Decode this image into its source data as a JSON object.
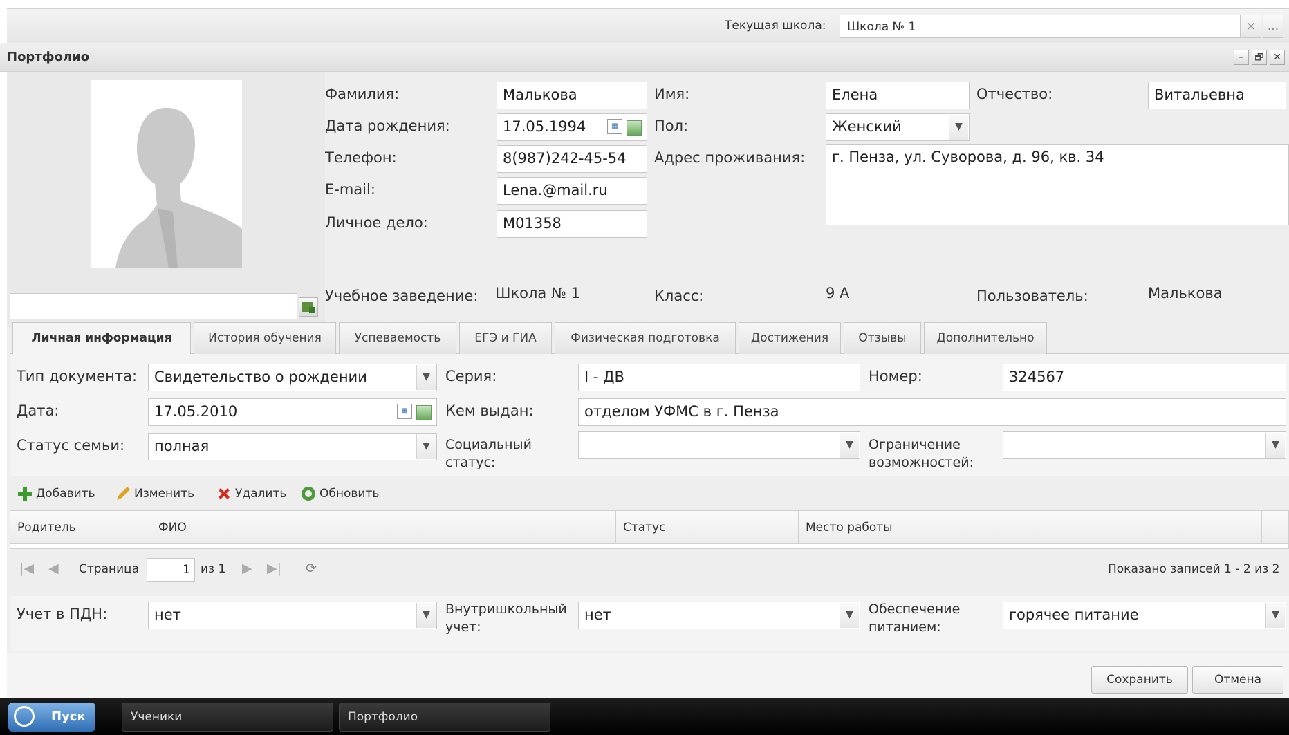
{
  "topbar": {
    "school_label": "Текущая школа:",
    "school_value": "Школа № 1",
    "clear_icon": "×",
    "more_icon": "..."
  },
  "window": {
    "title": "Портфолио",
    "min_icon": "–",
    "restore_icon": "🗗",
    "close_icon": "✕"
  },
  "personal": {
    "surname_label": "Фамилия:",
    "surname": "Малькова",
    "name_label": "Имя:",
    "name": "Елена",
    "patronymic_label": "Отчество:",
    "patronymic": "Витальевна",
    "birth_label": "Дата рождения:",
    "birth": "17.05.1994",
    "gender_label": "Пол:",
    "gender": "Женский",
    "phone_label": "Телефон:",
    "phone": "8(987)242-45-54",
    "address_label": "Адрес проживания:",
    "address": "г. Пенза, ул. Суворова, д. 96, кв. 34",
    "email_label": "E-mail:",
    "email": "Lena.@mail.ru",
    "case_label": "Личное дело:",
    "case": "М01358"
  },
  "summary": {
    "school_label": "Учебное заведение:",
    "school": "Школа № 1",
    "class_label": "Класс:",
    "class": "9 А",
    "user_label": "Пользователь:",
    "user": "Малькова"
  },
  "tabs": [
    "Личная информация",
    "История обучения",
    "Успеваемость",
    "ЕГЭ и ГИА",
    "Физическая подготовка",
    "Достижения",
    "Отзывы",
    "Дополнительно"
  ],
  "document": {
    "type_label": "Тип документа:",
    "type": "Свидетельство о рождении",
    "series_label": "Серия:",
    "series": "I - ДВ",
    "number_label": "Номер:",
    "number": "324567",
    "date_label": "Дата:",
    "date": "17.05.2010",
    "issued_label": "Кем выдан:",
    "issued": "отделом УФМС в г. Пенза",
    "family_label": "Статус семьи:",
    "family": "полная",
    "social_label_1": "Социальный",
    "social_label_2": "статус:",
    "social": "",
    "limit_label_1": "Ограничение",
    "limit_label_2": "возможностей:",
    "limit": ""
  },
  "toolbar": {
    "add": "Добавить",
    "edit": "Изменить",
    "delete": "Удалить",
    "refresh": "Обновить"
  },
  "grid": {
    "columns": [
      "Родитель",
      "ФИО",
      "Статус",
      "Место работы"
    ]
  },
  "pager": {
    "page_label": "Страница",
    "page": "1",
    "of": "из 1",
    "summary": "Показано записей 1 - 2 из 2"
  },
  "extra": {
    "pdn_label": "Учет в ПДН:",
    "pdn": "нет",
    "internal_label_1": "Внутришкольный",
    "internal_label_2": "учет:",
    "internal": "нет",
    "food_label_1": "Обеспечение",
    "food_label_2": "питанием:",
    "food": "горячее питание"
  },
  "buttons": {
    "save": "Сохранить",
    "cancel": "Отмена"
  },
  "taskbar": {
    "start": "Пуск",
    "task1": "Ученики",
    "task2": "Портфолио"
  }
}
